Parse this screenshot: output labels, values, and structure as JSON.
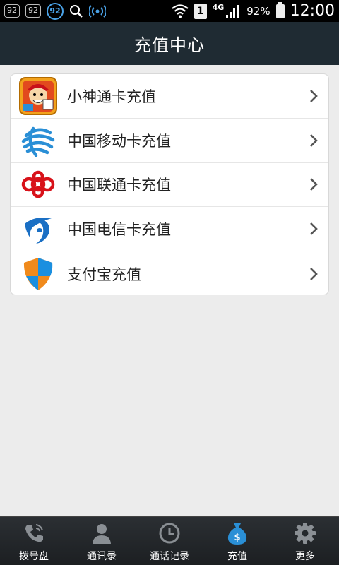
{
  "status_bar": {
    "badge1": "92",
    "badge2": "92",
    "circle": "92",
    "sim": "1",
    "network": "4G",
    "battery": "92%",
    "time": "12:00"
  },
  "header": {
    "title": "充值中心"
  },
  "menu": {
    "items": [
      {
        "label": "小神通卡充值",
        "icon": "game-character-icon"
      },
      {
        "label": "中国移动卡充值",
        "icon": "china-mobile-logo-icon"
      },
      {
        "label": "中国联通卡充值",
        "icon": "china-unicom-logo-icon"
      },
      {
        "label": "中国电信卡充值",
        "icon": "china-telecom-logo-icon"
      },
      {
        "label": "支付宝充值",
        "icon": "shield-icon"
      }
    ]
  },
  "bottom_nav": {
    "items": [
      {
        "label": "拨号盘",
        "icon": "phone-icon"
      },
      {
        "label": "通讯录",
        "icon": "contact-icon"
      },
      {
        "label": "通话记录",
        "icon": "clock-icon"
      },
      {
        "label": "充值",
        "icon": "money-bag-icon",
        "active": true
      },
      {
        "label": "更多",
        "icon": "gear-icon"
      }
    ]
  },
  "colors": {
    "header_bg": "#1f2b33",
    "accent_blue": "#2a8fd6",
    "unicom_red": "#d8121a",
    "shield_orange": "#f08a1c"
  }
}
